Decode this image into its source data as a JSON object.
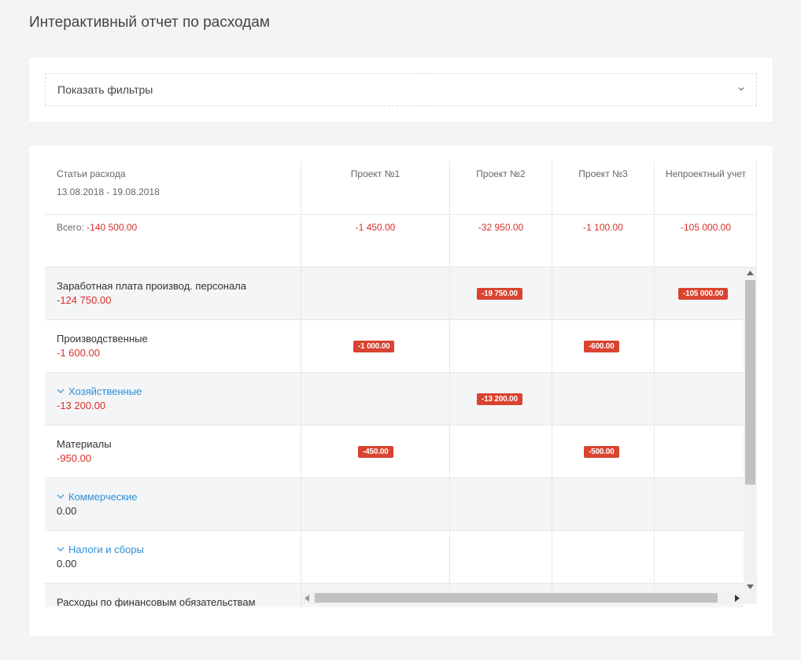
{
  "page": {
    "title": "Интерактивный отчет по расходам"
  },
  "filters": {
    "label": "Показать фильтры",
    "icon": "chevron-down-icon"
  },
  "table": {
    "header": {
      "first_col_title": "Статьи расхода",
      "date_range": "13.08.2018 - 19.08.2018",
      "columns": [
        "Проект №1",
        "Проект №2",
        "Проект №3",
        "Непроектный учет"
      ]
    },
    "totals": {
      "label": "Всего:",
      "value": "-140 500.00",
      "columns": [
        "-1 450.00",
        "-32 950.00",
        "-1 100.00",
        "-105 000.00"
      ]
    },
    "rows": [
      {
        "label": "Заработная плата производ. персонала",
        "value": "-124 750.00",
        "expandable": false,
        "cells": [
          "",
          "-19 750.00",
          "",
          "-105 000.00"
        ]
      },
      {
        "label": "Производственные",
        "value": "-1 600.00",
        "expandable": false,
        "cells": [
          "-1 000.00",
          "",
          "-600.00",
          ""
        ]
      },
      {
        "label": "Хозяйственные",
        "value": "-13 200.00",
        "expandable": true,
        "cells": [
          "",
          "-13 200.00",
          "",
          ""
        ]
      },
      {
        "label": "Материалы",
        "value": "-950.00",
        "expandable": false,
        "cells": [
          "-450.00",
          "",
          "-500.00",
          ""
        ]
      },
      {
        "label": "Коммерческие",
        "value": "0.00",
        "expandable": true,
        "cells": [
          "",
          "",
          "",
          ""
        ]
      },
      {
        "label": "Налоги и сборы",
        "value": "0.00",
        "expandable": true,
        "cells": [
          "",
          "",
          "",
          ""
        ]
      },
      {
        "label": "Расходы по финансовым обязательствам",
        "value": "",
        "expandable": false,
        "cells": [
          "",
          "",
          "",
          ""
        ]
      }
    ]
  },
  "colors": {
    "negative": "#d9302a",
    "badge": "#d9432f",
    "link": "#2d8fd6"
  }
}
